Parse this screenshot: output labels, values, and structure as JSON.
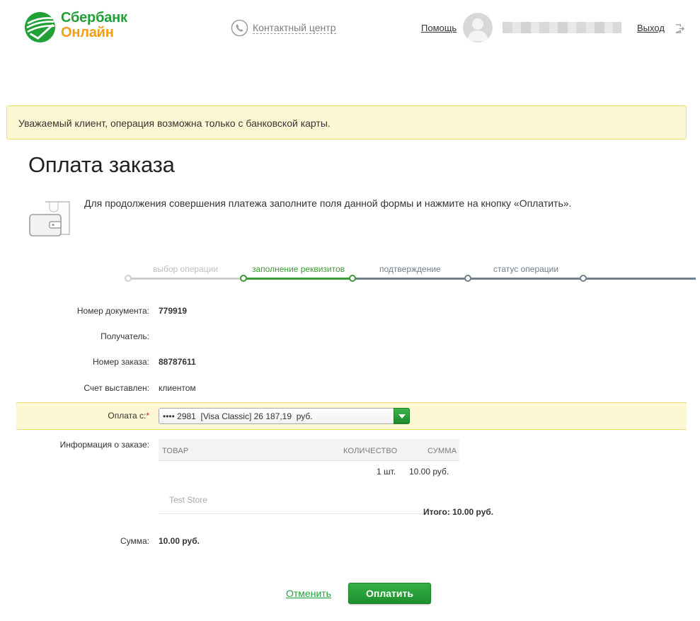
{
  "header": {
    "logo_line1": "Сбербанк",
    "logo_line2": "Онлайн",
    "contact_center": "Контактный центр",
    "help": "Помощь",
    "logout": "Выход"
  },
  "notice": "Уважаемый клиент, операция возможна только с банковской карты.",
  "page": {
    "title": "Оплата заказа",
    "intro": "Для продолжения совершения платежа заполните поля данной формы и нажмите на кнопку «Оплатить»."
  },
  "steps": [
    {
      "label": "выбор операции",
      "state": "done"
    },
    {
      "label": "заполнение реквизитов",
      "state": "active"
    },
    {
      "label": "подтверждение",
      "state": "pending"
    },
    {
      "label": "статус операции",
      "state": "pending"
    }
  ],
  "form": {
    "doc_number": {
      "label": "Номер документа:",
      "value": "779919"
    },
    "recipient": {
      "label": "Получатель:",
      "value": ""
    },
    "order_number": {
      "label": "Номер заказа:",
      "value": "88787611"
    },
    "invoiced": {
      "label": "Счет выставлен:",
      "value": "клиентом"
    },
    "pay_from": {
      "label": "Оплата с:",
      "required_mark": "*",
      "selected": "•••• 2981  [Visa Classic] 26 187,19  руб."
    },
    "order_info": {
      "label": "Информация о заказе:"
    }
  },
  "order_table": {
    "headers": {
      "item": "ТОВАР",
      "qty": "КОЛИЧЕСТВО",
      "sum": "СУММА"
    },
    "rows": [
      {
        "item": "",
        "qty": "1 шт.",
        "sum": "10.00  руб."
      }
    ],
    "store": "Test Store",
    "total": "Итого: 10.00 руб."
  },
  "sum": {
    "label": "Сумма:",
    "value": "10.00  руб."
  },
  "actions": {
    "cancel": "Отменить",
    "pay": "Оплатить"
  },
  "colors": {
    "brand_green": "#21a038",
    "brand_orange": "#f29e16",
    "notice_bg": "#fdf8d3",
    "step_pending": "#6f7f8c"
  }
}
